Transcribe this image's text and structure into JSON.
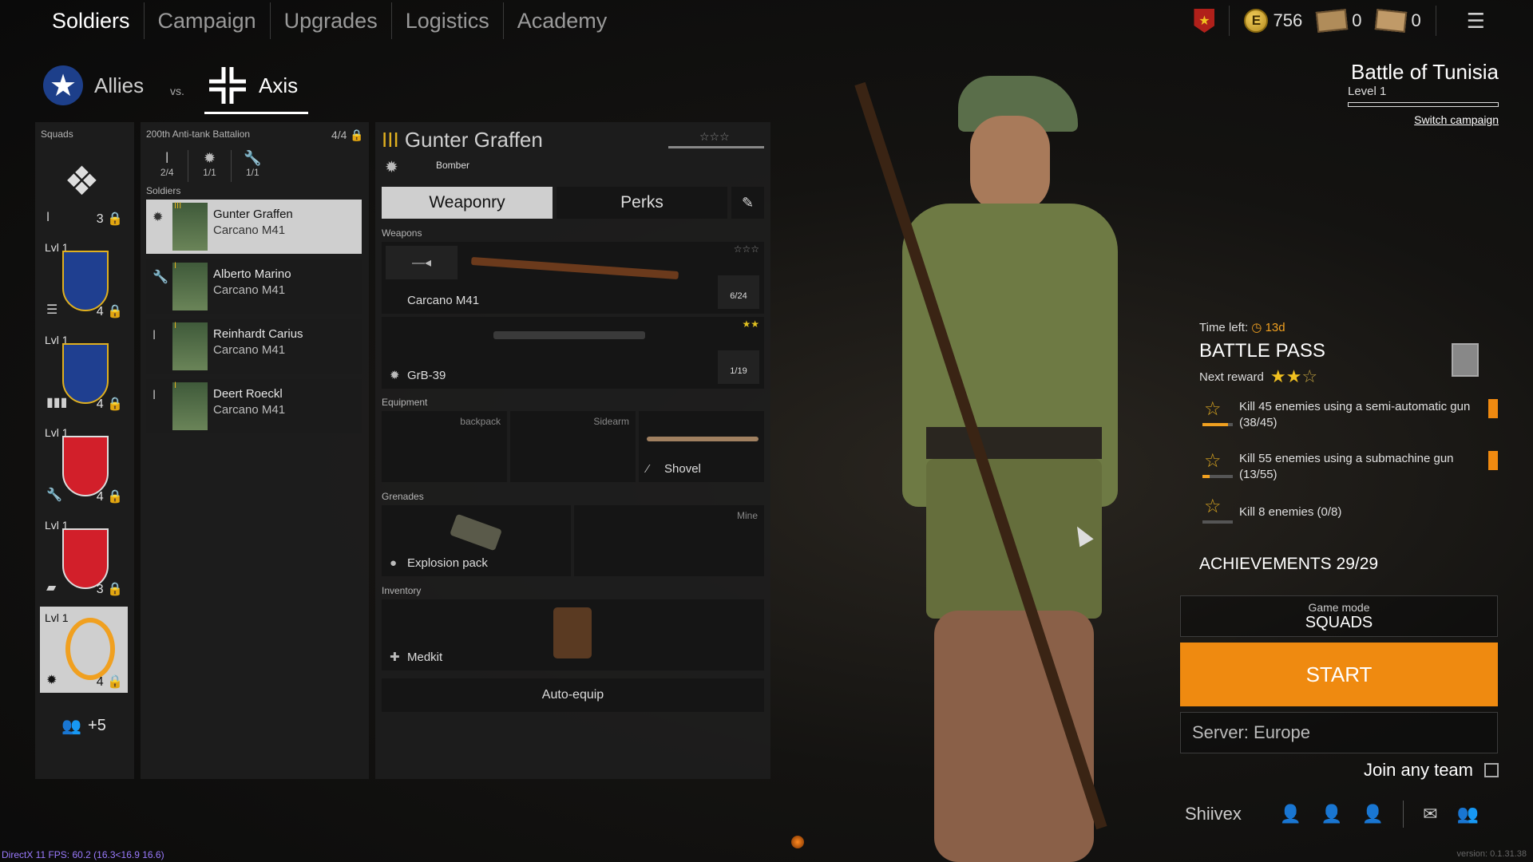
{
  "nav": {
    "tabs": [
      "Soldiers",
      "Campaign",
      "Upgrades",
      "Logistics",
      "Academy"
    ],
    "active": "Soldiers"
  },
  "resources": {
    "silver": "756",
    "tickets_a": "0",
    "tickets_b": "0"
  },
  "factions": {
    "allies": "Allies",
    "vs": "vs.",
    "axis": "Axis"
  },
  "squads": {
    "label": "Squads",
    "items": [
      {
        "lvl": "",
        "count": "3"
      },
      {
        "lvl": "Lvl 1",
        "count": "4"
      },
      {
        "lvl": "Lvl 1",
        "count": "4"
      },
      {
        "lvl": "Lvl 1",
        "count": "4"
      },
      {
        "lvl": "Lvl 1",
        "count": "3"
      },
      {
        "lvl": "Lvl 1",
        "count": "4"
      }
    ],
    "extra": "+5"
  },
  "battalion": {
    "name": "200th Anti-tank Battalion",
    "count": "4/4",
    "slots": [
      "2/4",
      "1/1",
      "1/1"
    ],
    "soldiers_label": "Soldiers",
    "soldiers": [
      {
        "name": "Gunter Graffen",
        "weapon": "Carcano M41",
        "rank": "III"
      },
      {
        "name": "Alberto Marino",
        "weapon": "Carcano M41",
        "rank": "I"
      },
      {
        "name": "Reinhardt Carius",
        "weapon": "Carcano M41",
        "rank": "I"
      },
      {
        "name": "Deert Roeckl",
        "weapon": "Carcano M41",
        "rank": "I"
      }
    ]
  },
  "soldier": {
    "rank": "III",
    "name": "Gunter Graffen",
    "class": "Bomber",
    "tabs": {
      "weaponry": "Weaponry",
      "perks": "Perks"
    },
    "weapons_label": "Weapons",
    "primary": {
      "name": "Carcano M41",
      "ammo": "6/24"
    },
    "secondary": {
      "name": "GrB-39",
      "ammo": "1/19"
    },
    "equipment_label": "Equipment",
    "equip_slots": {
      "backpack": "backpack",
      "sidearm": "Sidearm",
      "melee": "Shovel"
    },
    "grenades_label": "Grenades",
    "grenade": "Explosion pack",
    "mine_label": "Mine",
    "inventory_label": "Inventory",
    "inventory_item": "Medkit",
    "auto_equip": "Auto-equip"
  },
  "campaign": {
    "title": "Battle of Tunisia",
    "level": "Level 1",
    "switch": "Switch campaign"
  },
  "battlepass": {
    "time_left_label": "Time left:",
    "time_left": "13d",
    "title": "BATTLE PASS",
    "next_reward": "Next reward",
    "tasks": [
      {
        "text": "Kill 45 enemies using a semi-automatic gun (38/45)",
        "progress": 0.84,
        "flag": true
      },
      {
        "text": "Kill 55 enemies using a submachine gun (13/55)",
        "progress": 0.24,
        "flag": true
      },
      {
        "text": "Kill 8 enemies (0/8)",
        "progress": 0.0,
        "flag": false
      }
    ]
  },
  "achievements": "ACHIEVEMENTS 29/29",
  "game_mode": {
    "label": "Game mode",
    "value": "SQUADS"
  },
  "start": "START",
  "server": "Server: Europe",
  "join_any_team": "Join any team",
  "player": "Shiivex",
  "debug": "DirectX 11 FPS: 60.2 (16.3<16.9 16.6)",
  "version": "version: 0.1.31.38"
}
